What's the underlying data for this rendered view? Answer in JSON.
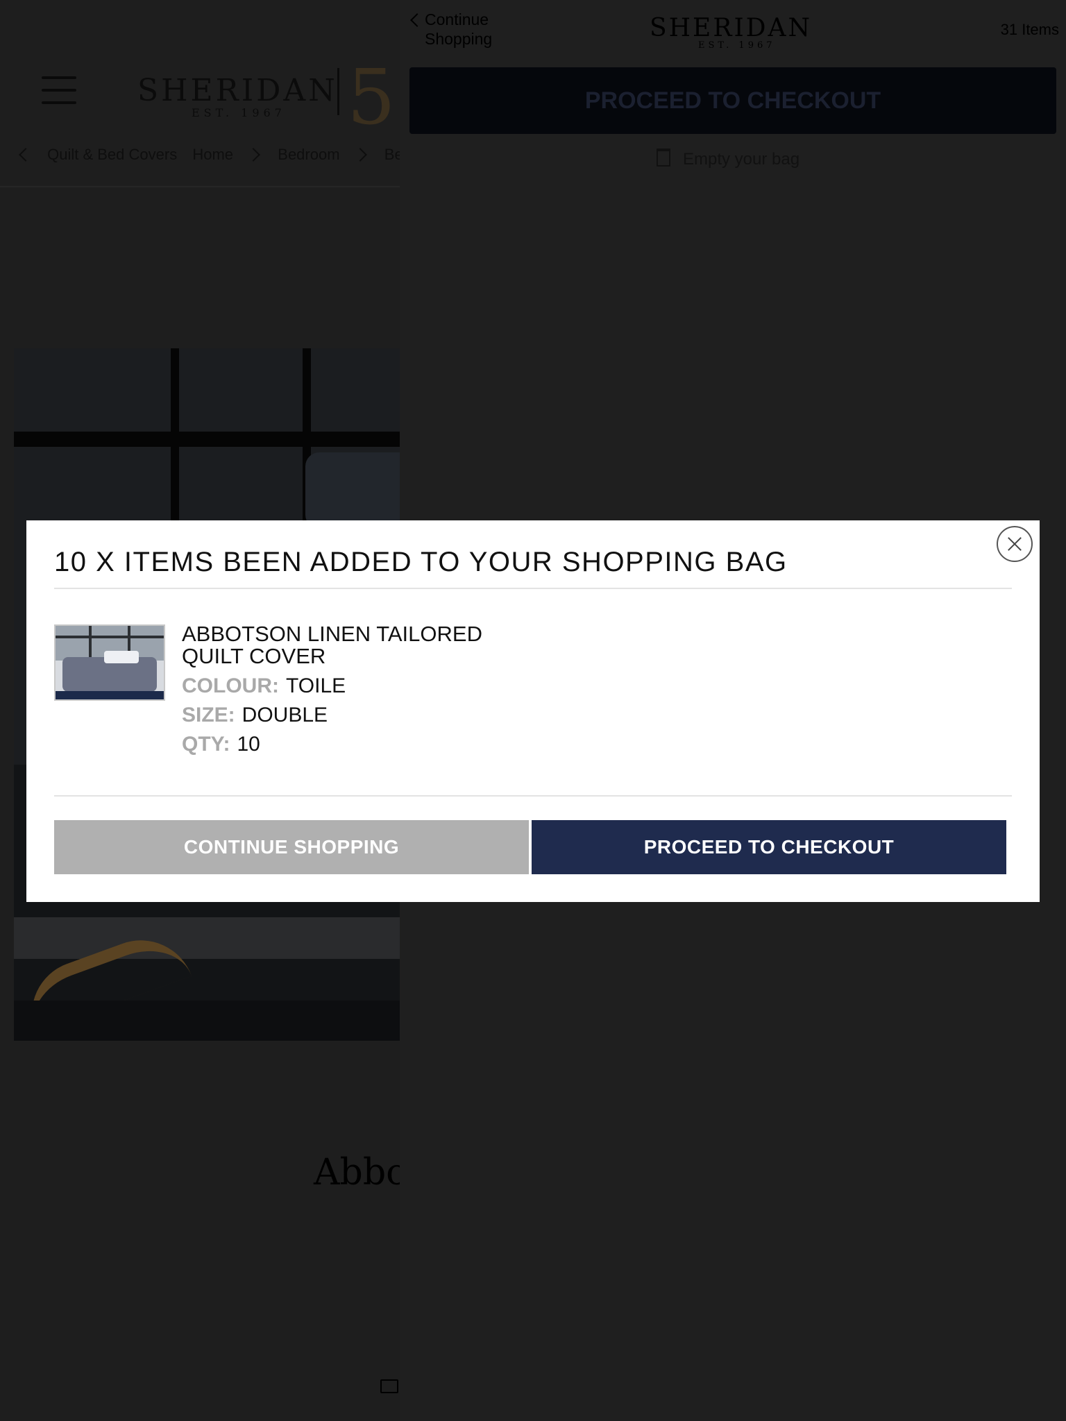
{
  "background_page": {
    "logo": {
      "word": "SHERIDAN",
      "est": "EST. 1967"
    },
    "anniversary_glyph": "5",
    "breadcrumb": [
      "Quilt & Bed Covers",
      "Home",
      "Bedroom",
      "Bedr"
    ],
    "product_name_partial": "Abbot"
  },
  "cart_panel": {
    "continue_shopping": "Continue Shopping",
    "logo": {
      "word": "SHERIDAN",
      "est": "EST. 1967"
    },
    "item_count": "31 Items",
    "checkout_label": "PROCEED TO CHECKOUT",
    "empty_bag_label": "Empty your bag"
  },
  "modal": {
    "title": "10 X ITEMS BEEN ADDED TO YOUR SHOPPING BAG",
    "product": {
      "name": "ABBOTSON LINEN TAILORED QUILT COVER",
      "colour_key": "COLOUR:",
      "colour_value": "TOILE",
      "size_key": "SIZE:",
      "size_value": "DOUBLE",
      "qty_key": "QTY:",
      "qty_value": "10"
    },
    "continue_button": "CONTINUE SHOPPING",
    "checkout_button": "PROCEED TO CHECKOUT"
  },
  "colors": {
    "overlay": "#1f1f1f",
    "checkout_navy": "#1f2b4e",
    "continue_grey": "#b0b0b0",
    "attr_key_grey": "#a9a9a9"
  }
}
